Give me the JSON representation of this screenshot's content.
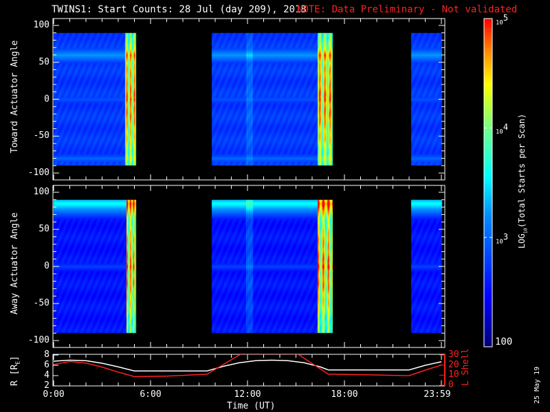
{
  "title": {
    "main": "TWINS1: Start Counts: 28 Jul (day 209), 2018",
    "note": "NOTE: Data Preliminary - Not validated",
    "note_color": "#ff2020"
  },
  "date_stamp": "25 May 19",
  "chart_data": [
    {
      "type": "heatmap",
      "name": "toward",
      "ylabel": "Toward Actuator Angle",
      "ylim": [
        -100,
        100
      ],
      "yticks": [
        "100",
        "50",
        "0",
        "-50",
        "-100"
      ],
      "data_angle_range": [
        -90,
        90
      ],
      "data_intervals_hours": [
        [
          0,
          5.1
        ],
        [
          9.75,
          17.25
        ],
        [
          22.1,
          24
        ]
      ],
      "background_log10": 2.75,
      "bands": [
        {
          "angle_center": 60,
          "log10": 3.25
        },
        {
          "angle_center": 0,
          "log10": 2.9
        },
        {
          "angle_center": -80,
          "log10": 3.0
        }
      ],
      "bright_intervals": [
        {
          "hours": [
            4.4,
            5.1
          ],
          "log10_peak": 4.9
        },
        {
          "hours": [
            16.3,
            17.25
          ],
          "log10_peak": 4.9
        },
        {
          "hours": [
            11.9,
            12.3
          ],
          "log10_peak": 3.1
        }
      ]
    },
    {
      "type": "heatmap",
      "name": "away",
      "ylabel": "Away Actuator Angle",
      "ylim": [
        -100,
        100
      ],
      "yticks": [
        "100",
        "50",
        "0",
        "-50",
        "-100"
      ],
      "data_angle_range": [
        -90,
        90
      ],
      "data_intervals_hours": [
        [
          0,
          5.1
        ],
        [
          9.75,
          17.25
        ],
        [
          22.1,
          24
        ]
      ],
      "background_log10": 2.55,
      "bands": [
        {
          "angle_center": 85,
          "log10": 3.6
        },
        {
          "angle_center": 0,
          "log10": 2.8
        }
      ],
      "bright_intervals": [
        {
          "hours": [
            4.5,
            5.1
          ],
          "log10_peak": 4.9
        },
        {
          "hours": [
            16.3,
            17.25
          ],
          "log10_peak": 4.9
        },
        {
          "hours": [
            11.9,
            12.3
          ],
          "log10_peak": 3.0
        }
      ]
    },
    {
      "type": "line",
      "name": "orbit",
      "xlabel": "Time (UT)",
      "xticks": [
        "0:00",
        "6:00",
        "12:00",
        "18:00",
        "23:59"
      ],
      "ylabel": "R [R",
      "ylabel_sub": "E",
      "ylabel_end": "]",
      "ylim": [
        1.5,
        8.3
      ],
      "yticks": [
        "8",
        "6",
        "4",
        "2"
      ],
      "y2label": "L Shell",
      "y2lim": [
        0,
        30
      ],
      "y2ticks": [
        "30",
        "20",
        "10",
        "0"
      ],
      "series": [
        {
          "name": "R",
          "color": "#ffffff",
          "x": [
            0,
            1,
            2,
            3,
            4,
            5,
            7,
            9.5,
            10.5,
            11.5,
            12.5,
            13.5,
            14.5,
            15.5,
            16.5,
            17,
            19,
            22,
            23,
            24
          ],
          "y": [
            6.8,
            7.0,
            6.9,
            6.4,
            5.7,
            4.9,
            4.9,
            4.9,
            5.8,
            6.5,
            6.9,
            7.0,
            6.9,
            6.5,
            5.7,
            5.1,
            5.1,
            5.1,
            6.0,
            6.7
          ]
        },
        {
          "name": "L Shell",
          "color": "#ff2020",
          "x": [
            0,
            1,
            2,
            3,
            4,
            5,
            7,
            9.5,
            11.6,
            15.1,
            17,
            19,
            22,
            23,
            24
          ],
          "y": [
            20.5,
            23.5,
            22,
            18,
            13,
            8.5,
            9,
            11,
            31,
            31,
            11,
            10.5,
            9.5,
            15,
            20
          ]
        }
      ]
    }
  ],
  "colorbar": {
    "label": "LOG",
    "label_sub": "10",
    "label_rest": "(Total Starts per Scan)",
    "min": 100,
    "max": 100000,
    "ticks": [
      {
        "base": "10",
        "exp": "5",
        "log10": 5
      },
      {
        "base": "10",
        "exp": "4",
        "log10": 4
      },
      {
        "base": "10",
        "exp": "3",
        "log10": 3
      }
    ],
    "min_label": "100"
  }
}
